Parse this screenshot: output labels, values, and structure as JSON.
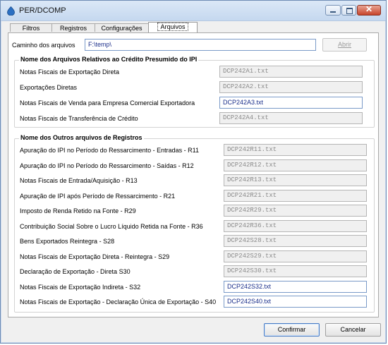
{
  "window": {
    "title": "PER/DCOMP",
    "icon": "perdcomp-app-icon",
    "controls": [
      "minimize-icon",
      "maximize-icon",
      "close-icon"
    ]
  },
  "tabs": [
    {
      "label": "Filtros",
      "active": false
    },
    {
      "label": "Registros",
      "active": false
    },
    {
      "label": "Configurações",
      "active": false
    },
    {
      "label": "Arquivos",
      "active": true
    }
  ],
  "path": {
    "label": "Caminho dos arquivos",
    "value": "F:\\temp\\",
    "open_button": "Abrir"
  },
  "group1": {
    "title": "Nome dos Arquivos Relativos ao Crédito Presumido do IPI",
    "rows": [
      {
        "label": "Notas Fiscais de Exportação Direta",
        "value": "DCP242A1.txt",
        "enabled": false
      },
      {
        "label": "Exportações Diretas",
        "value": "DCP242A2.txt",
        "enabled": false
      },
      {
        "label": "Notas Fiscais de Venda para Empresa Comercial Exportadora",
        "value": "DCP242A3.txt",
        "enabled": true
      },
      {
        "label": "Notas Fiscais de Transferência de Crédito",
        "value": "DCP242A4.txt",
        "enabled": false
      }
    ]
  },
  "group2": {
    "title": "Nome dos Outros arquivos de Registros",
    "rows": [
      {
        "label": "Apuração do IPI no Período do Ressarcimento - Entradas - R11",
        "value": "DCP242R11.txt",
        "enabled": false
      },
      {
        "label": "Apuração do IPI no Período do Ressarcimento - Saídas - R12",
        "value": "DCP242R12.txt",
        "enabled": false
      },
      {
        "label": "Notas Fiscais de Entrada/Aquisição - R13",
        "value": "DCP242R13.txt",
        "enabled": false
      },
      {
        "label": "Apuração de IPI após Período de Ressarcimento - R21",
        "value": "DCP242R21.txt",
        "enabled": false
      },
      {
        "label": "Imposto de Renda Retido na Fonte - R29",
        "value": "DCP242R29.txt",
        "enabled": false
      },
      {
        "label": "Contribuição Social Sobre o Lucro Líquido Retida na Fonte - R36",
        "value": "DCP242R36.txt",
        "enabled": false
      },
      {
        "label": "Bens Exportados Reintegra - S28",
        "value": "DCP242S28.txt",
        "enabled": false
      },
      {
        "label": "Notas Fiscais de Exportação Direta - Reintegra - S29",
        "value": "DCP242S29.txt",
        "enabled": false
      },
      {
        "label": "Declaração de Exportação - Direta S30",
        "value": "DCP242S30.txt",
        "enabled": false
      },
      {
        "label": "Notas Fiscais de Exportação Indireta - S32",
        "value": "DCP242S32.txt",
        "enabled": true
      },
      {
        "label": "Notas Fiscais de Exportação - Declaração Única de Exportação - S40",
        "value": "DCP242S40.txt",
        "enabled": true
      }
    ]
  },
  "footer": {
    "confirm": "Confirmar",
    "cancel": "Cancelar"
  }
}
